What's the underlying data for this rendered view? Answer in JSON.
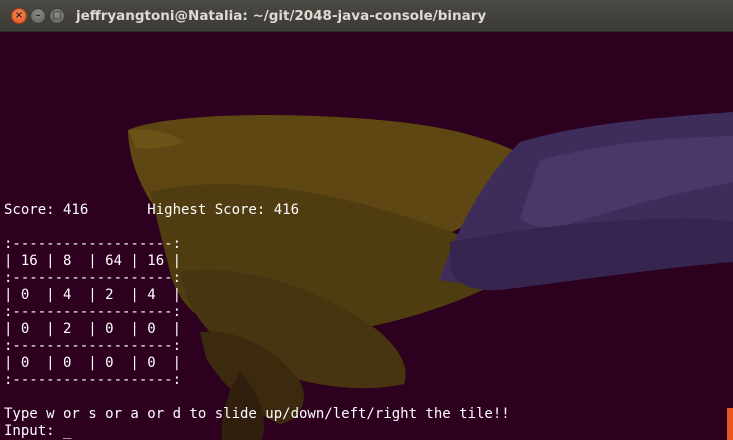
{
  "window": {
    "title": "jeffryangtoni@Natalia: ~/git/2048-java-console/binary",
    "controls": {
      "close": "×",
      "minimize": "–",
      "maximize": "□"
    }
  },
  "terminal": {
    "score_line": "Score: 416       Highest Score: 416",
    "board": {
      "separator": ":-------------------:",
      "rows": [
        "| 16 | 8  | 64 | 16 |",
        "| 0  | 4  | 2  | 4  |",
        "| 0  | 2  | 0  | 0  |",
        "| 0  | 0  | 0  | 0  |"
      ]
    },
    "instruction": "Type w or s or a or d to slide up/down/left/right the tile!!",
    "prompt": "Input: _"
  },
  "colors": {
    "terminal_background": "#2c001e",
    "text": "#ffffff",
    "titlebar": "#3c3b37",
    "close_button": "#e2541c",
    "accent": "#e95420"
  }
}
